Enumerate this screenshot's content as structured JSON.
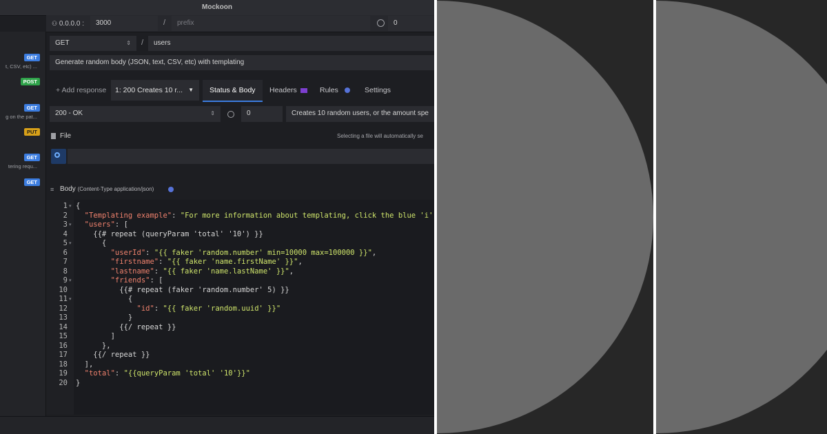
{
  "window": {
    "title": "Mockoon"
  },
  "topbar": {
    "host": "0.0.0.0 :",
    "port": "3000",
    "slash": "/",
    "prefix_placeholder": "prefix",
    "latency": "0"
  },
  "route": {
    "method": "GET",
    "path": "users",
    "description": "Generate random body (JSON, text, CSV, etc) with templating"
  },
  "tabs": {
    "add_response": "+ Add response",
    "response_selector": "1: 200   Creates 10 r...",
    "status_body": "Status & Body",
    "headers": "Headers",
    "rules": "Rules",
    "settings": "Settings"
  },
  "response": {
    "status": "200 - OK",
    "latency": "0",
    "description": "Creates 10 random users, or the amount spe"
  },
  "file": {
    "label": "File",
    "hint": "Selecting a file will automatically se"
  },
  "body": {
    "label": "Body",
    "content_type": "(Content-Type application/json)"
  },
  "sidebar": {
    "routes": [
      {
        "method": "GET",
        "desc": "t, CSV, etc) ..."
      },
      {
        "method": "POST",
        "desc": ""
      },
      {
        "method": "GET",
        "desc": "g on the pat..."
      },
      {
        "method": "PUT",
        "desc": ""
      },
      {
        "method": "GET",
        "desc": "tering requ..."
      },
      {
        "method": "GET",
        "desc": ""
      }
    ]
  },
  "editor": {
    "line_numbers": [
      "1",
      "2",
      "3",
      "4",
      "5",
      "6",
      "7",
      "8",
      "9",
      "10",
      "11",
      "12",
      "13",
      "14",
      "15",
      "16",
      "17",
      "18",
      "19",
      "20"
    ],
    "lines": [
      "{",
      "  \"Templating example\": \"For more information about templating, click the blue 'i' a",
      "  \"users\": [",
      "    {{# repeat (queryParam 'total' '10') }}",
      "      {",
      "        \"userId\": \"{{ faker 'random.number' min=10000 max=100000 }}\",",
      "        \"firstname\": \"{{ faker 'name.firstName' }}\",",
      "        \"lastname\": \"{{ faker 'name.lastName' }}\",",
      "        \"friends\": [",
      "          {{# repeat (faker 'random.number' 5) }}",
      "            {",
      "              \"id\": \"{{ faker 'random.uuid' }}\"",
      "            }",
      "          {{/ repeat }}",
      "        ]",
      "      },",
      "    {{/ repeat }}",
      "  ],",
      "  \"total\": \"{{queryParam 'total' '10'}}\"",
      "}"
    ]
  },
  "colors": {
    "app_bg": "#1d1e22",
    "panel_bg": "#272727",
    "circle": "#6a6a6a",
    "accent": "#3c7de0",
    "key": "#f0826d",
    "string": "#cfe56b"
  }
}
